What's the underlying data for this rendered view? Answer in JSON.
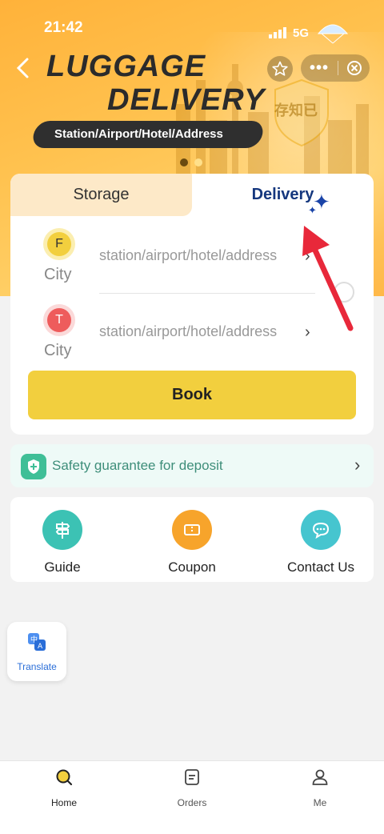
{
  "status_bar": {
    "time": "21:42",
    "network": "5G"
  },
  "banner": {
    "title_line1": "LUGGAGE",
    "title_line2": "DELIVERY",
    "subtitle": "Station/Airport/Hotel/Address",
    "watermark": "存知已"
  },
  "tabs": [
    {
      "label": "Storage",
      "active": false
    },
    {
      "label": "Delivery",
      "active": true
    }
  ],
  "from": {
    "badge": "F",
    "city": "City",
    "placeholder": "station/airport/hotel/address"
  },
  "to": {
    "badge": "T",
    "city": "City",
    "placeholder": "station/airport/hotel/address"
  },
  "book_label": "Book",
  "safety": {
    "text": "Safety guarantee for deposit"
  },
  "actions": [
    {
      "label": "Guide",
      "icon": "signpost-icon",
      "color": "#3cc2b4"
    },
    {
      "label": "Coupon",
      "icon": "ticket-icon",
      "color": "#f7a42b"
    },
    {
      "label": "Contact Us",
      "icon": "chat-icon",
      "color": "#46c5cf"
    }
  ],
  "translate_label": "Translate",
  "nav": [
    {
      "label": "Home",
      "icon": "search-icon",
      "active": true
    },
    {
      "label": "Orders",
      "icon": "orders-icon",
      "active": false
    },
    {
      "label": "Me",
      "icon": "person-icon",
      "active": false
    }
  ],
  "colors": {
    "accent_yellow": "#f2cf3e",
    "delivery_blue": "#15377e",
    "safety_green": "#3fbf97",
    "annotation_red": "#e8283a"
  }
}
